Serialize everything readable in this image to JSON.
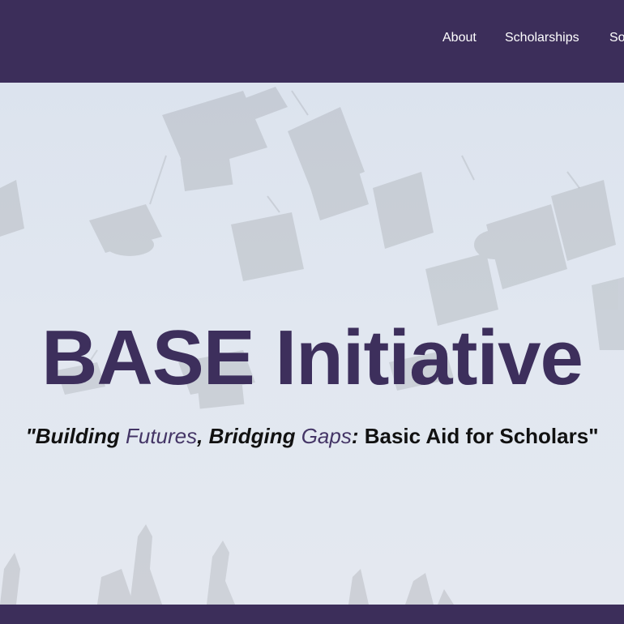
{
  "nav": {
    "items": [
      "About",
      "Scholarships",
      "So"
    ]
  },
  "hero": {
    "title": "BASE Initiative",
    "tagline": {
      "open_quote": "\"",
      "building": "Building ",
      "futures": "Futures",
      "comma": ", ",
      "bridging": "Bridging ",
      "gaps": "Gaps",
      "colon": ":",
      "rest": " Basic Aid for Scholars",
      "close_quote": "\""
    },
    "background_image": "graduation-caps-thrown-in-sky"
  },
  "colors": {
    "header_bg": "#3c2e5a",
    "title": "#3d2f5c",
    "accent_words": "#443566",
    "hero_bg": "#dfe6ef"
  }
}
